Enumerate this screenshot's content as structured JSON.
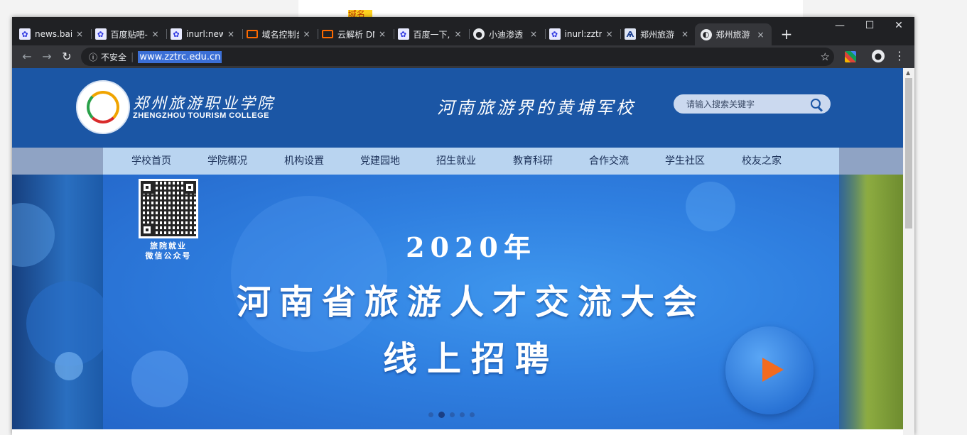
{
  "background": {
    "highlight_text": "域名"
  },
  "tabs": [
    {
      "title": "news.baidu",
      "favicon": "baidu-paw-icon"
    },
    {
      "title": "百度贴吧-",
      "favicon": "baidu-paw-icon"
    },
    {
      "title": "inurl:news",
      "favicon": "baidu-paw-icon"
    },
    {
      "title": "域名控制台",
      "favicon": "aliyun-icon"
    },
    {
      "title": "云解析 DN",
      "favicon": "aliyun-icon"
    },
    {
      "title": "百度一下,",
      "favicon": "baidu-paw-icon"
    },
    {
      "title": "小迪渗透",
      "favicon": "globe-icon"
    },
    {
      "title": "inurl:zztr",
      "favicon": "baidu-paw-icon"
    },
    {
      "title": "郑州旅游",
      "favicon": "zztrc-icon"
    },
    {
      "title": "郑州旅游",
      "favicon": "zztrc-globe-icon",
      "active": true
    }
  ],
  "tab_close_glyph": "×",
  "new_tab_glyph": "+",
  "window_controls": {
    "minimize": "—",
    "maximize": "☐",
    "close": "✕"
  },
  "toolbar": {
    "back": "←",
    "forward": "→",
    "reload": "↻",
    "info_glyph": "ⓘ",
    "security_label": "不安全",
    "url": "www.zztrc.edu.cn",
    "star": "☆",
    "menu": "⋮"
  },
  "site": {
    "logo_cn": "郑州旅游职业学院",
    "logo_en": "ZHENGZHOU TOURISM COLLEGE",
    "slogan": "河南旅游界的黄埔军校",
    "search_placeholder": "请输入搜索关键字",
    "nav": [
      "学校首页",
      "学院概况",
      "机构设置",
      "党建园地",
      "招生就业",
      "教育科研",
      "合作交流",
      "学生社区",
      "校友之家"
    ]
  },
  "banner": {
    "qr_caption_line1": "旅院就业",
    "qr_caption_line2": "微信公众号",
    "year": "2020年",
    "title": "河南省旅游人才交流大会",
    "subtitle": "线上招聘",
    "slide_count": 5,
    "active_slide": 2
  },
  "colors": {
    "header_blue": "#1b56a5",
    "nav_bg": "#b9d4f0",
    "banner_blue": "#2f7fe0",
    "play_arrow": "#f36b1e"
  }
}
